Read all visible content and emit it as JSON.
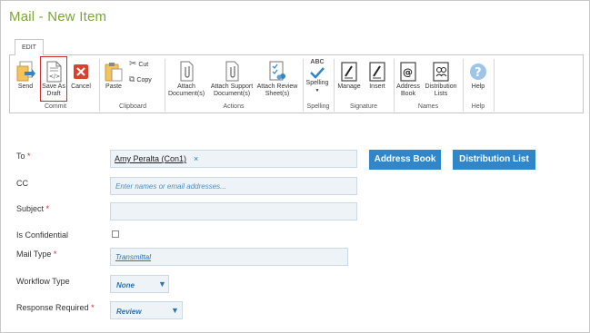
{
  "window": {
    "title": "Mail - New Item"
  },
  "ribbon": {
    "tab": "EDIT",
    "groups": {
      "commit": "Commit",
      "clipboard": "Clipboard",
      "actions": "Actions",
      "spelling": "Spelling",
      "signature": "Signature",
      "names": "Names",
      "help": "Help"
    },
    "buttons": {
      "send": "Send",
      "save_draft_1": "Save As",
      "save_draft_2": "Draft",
      "cancel": "Cancel",
      "paste": "Paste",
      "cut": "Cut",
      "copy": "Copy",
      "attach_docs_1": "Attach",
      "attach_docs_2": "Document(s)",
      "attach_support_1": "Attach Support",
      "attach_support_2": "Document(s)",
      "attach_review_1": "Attach Review",
      "attach_review_2": "Sheet(s)",
      "spelling_abc": "ABC",
      "spelling": "Spelling",
      "manage": "Manage",
      "insert": "Insert",
      "address_book_1": "Address",
      "address_book_2": "Book",
      "distribution_1": "Distribution",
      "distribution_2": "Lists",
      "help": "Help"
    }
  },
  "form": {
    "to": {
      "label": "To",
      "req": "*",
      "recipient": "Amy Peralta (Con1)",
      "remove": "×"
    },
    "address_book_button": "Address Book",
    "distribution_list_button": "Distribution List",
    "cc": {
      "label": "CC",
      "placeholder": "Enter names or email addresses..."
    },
    "subject": {
      "label": "Subject",
      "req": "*",
      "value": ""
    },
    "confidential": {
      "label": "Is Confidential",
      "checked": false
    },
    "mail_type": {
      "label": "Mail Type",
      "req": "*",
      "value": "Transmittal"
    },
    "workflow_type": {
      "label": "Workflow Type",
      "value": "None",
      "arrow": "▼"
    },
    "response_required": {
      "label": "Response Required",
      "req": "*",
      "value": "Review",
      "arrow": "▼"
    }
  },
  "colors": {
    "accent": "#2f86c9",
    "title": "#7aa63a",
    "required": "#d22a2a",
    "highlight": "#d22a2a"
  }
}
